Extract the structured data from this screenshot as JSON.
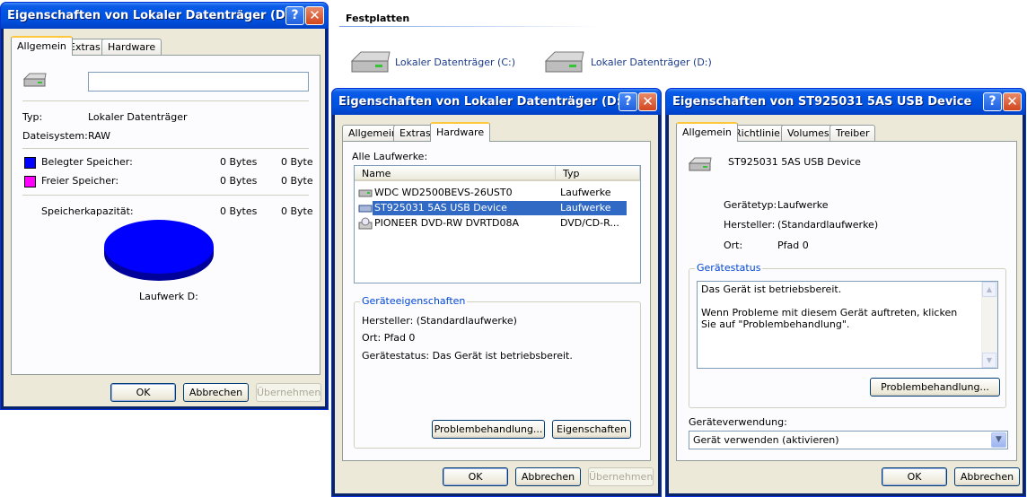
{
  "explorer": {
    "heading": "Festplatten",
    "drives": [
      {
        "label": "Lokaler Datenträger (C:)"
      },
      {
        "label": "Lokaler Datenträger (D:)"
      }
    ]
  },
  "dialog1": {
    "title": "Eigenschaften von Lokaler Datenträger (D:)",
    "tabs": [
      "Allgemein",
      "Extras",
      "Hardware"
    ],
    "name_value": "",
    "type_label": "Typ:",
    "type_value": "Lokaler Datenträger",
    "fs_label": "Dateisystem:",
    "fs_value": "RAW",
    "used_label": "Belegter Speicher:",
    "used_bytes": "0 Bytes",
    "used_short": "0 Byte",
    "free_label": "Freier Speicher:",
    "free_bytes": "0 Bytes",
    "free_short": "0 Byte",
    "cap_label": "Speicherkapazität:",
    "cap_bytes": "0 Bytes",
    "cap_short": "0 Byte",
    "drive_label": "Laufwerk D:",
    "ok": "OK",
    "cancel": "Abbrechen",
    "apply": "Übernehmen",
    "used_color": "#0000ff",
    "free_color": "#ff00ff"
  },
  "dialog2": {
    "title": "Eigenschaften von Lokaler Datenträger (D:)",
    "tabs": [
      "Allgemein",
      "Extras",
      "Hardware"
    ],
    "all_drives_label": "Alle Laufwerke:",
    "col_name": "Name",
    "col_type": "Typ",
    "rows": [
      {
        "name": "WDC WD2500BEVS-26UST0",
        "type": "Laufwerke"
      },
      {
        "name": "ST925031 5AS USB Device",
        "type": "Laufwerke"
      },
      {
        "name": "PIONEER DVD-RW  DVRTD08A",
        "type": "DVD/CD-R..."
      }
    ],
    "group_title": "Geräteeigenschaften",
    "manufacturer": "Hersteller: (Standardlaufwerke)",
    "location": "Ort: Pfad 0",
    "status": "Gerätestatus: Das Gerät ist betriebsbereit.",
    "troubleshoot": "Problembehandlung...",
    "properties": "Eigenschaften",
    "ok": "OK",
    "cancel": "Abbrechen",
    "apply": "Übernehmen"
  },
  "dialog3": {
    "title": "Eigenschaften von ST925031 5AS USB Device",
    "tabs": [
      "Allgemein",
      "Richtlinien",
      "Volumes",
      "Treiber"
    ],
    "device_name": "ST925031 5AS USB Device",
    "type_label": "Gerätetyp:",
    "type_value": "Laufwerke",
    "mfr_label": "Hersteller:",
    "mfr_value": "(Standardlaufwerke)",
    "loc_label": "Ort:",
    "loc_value": "Pfad 0",
    "status_group": "Gerätestatus",
    "status_line1": "Das Gerät ist betriebsbereit.",
    "status_line2": "Wenn Probleme mit diesem Gerät auftreten, klicken Sie auf \"Problembehandlung\".",
    "troubleshoot": "Problembehandlung...",
    "usage_label": "Geräteverwendung:",
    "usage_value": "Gerät verwenden (aktivieren)",
    "ok": "OK",
    "cancel": "Abbrechen"
  }
}
